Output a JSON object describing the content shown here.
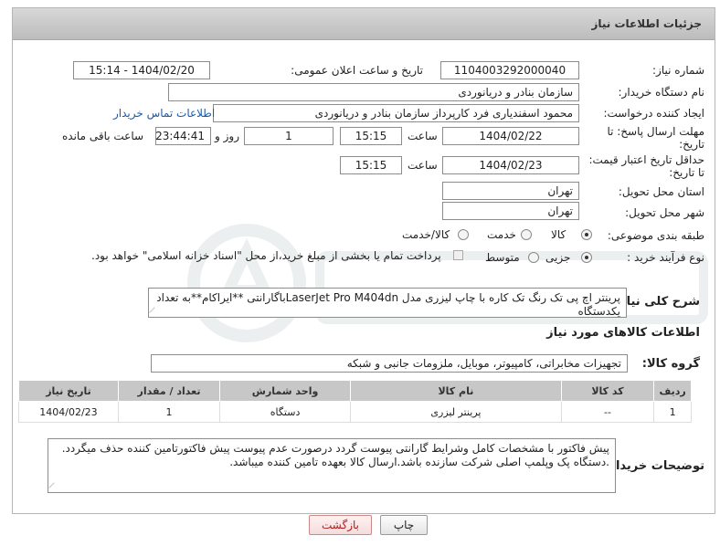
{
  "panel": {
    "title": "جزئیات اطلاعات نیاز"
  },
  "form": {
    "need_number": {
      "label": "شماره نیاز:",
      "value": "1104003292000040"
    },
    "announce": {
      "label": "تاریخ و ساعت اعلان عمومی:",
      "value": "1404/02/20 - 15:14"
    },
    "buyer_org": {
      "label": "نام دستگاه خریدار:",
      "value": "سازمان بنادر و دریانوردی"
    },
    "creator": {
      "label": "ایجاد کننده درخواست:",
      "value": "محمود اسفندیاری فرد کارپرداز سازمان بنادر و دریانوردی",
      "contact_link": "اطلاعات تماس خریدار"
    },
    "deadline": {
      "label_line1": "مهلت ارسال پاسخ: تا",
      "label_line2": "تاریخ:",
      "date": "1404/02/22",
      "time_label": "ساعت",
      "time": "15:15",
      "days": "1",
      "days_label": "روز و",
      "remaining": "23:44:41",
      "remaining_label": "ساعت باقی مانده"
    },
    "price_validity": {
      "label_line1": "حداقل تاریخ اعتبار قیمت:",
      "label_line2": "تا تاریخ:",
      "date": "1404/02/23",
      "time_label": "ساعت",
      "time": "15:15"
    },
    "province": {
      "label": "استان محل تحویل:",
      "value": "تهران"
    },
    "city": {
      "label": "شهر محل تحویل:",
      "value": "تهران"
    },
    "category": {
      "label": "طبقه بندی موضوعی:",
      "options": [
        "کالا",
        "خدمت",
        "کالا/خدمت"
      ],
      "selected": "کالا"
    },
    "purchase_process": {
      "label": "نوع فرآیند خرید :",
      "options": [
        "جزیی",
        "متوسط"
      ],
      "selected": "جزیی",
      "note": "پرداخت تمام یا بخشی از مبلغ خرید،از محل \"اسناد خزانه اسلامی\" خواهد بود."
    },
    "description": {
      "label": "شرح کلی نیاز:",
      "value": "پرینتر اچ پی تک رنگ تک کاره با چاپ لیزری مدل LaserJet Pro M404dnباگارانتی **ایراکام**به تعداد یکدستگاه"
    }
  },
  "goods": {
    "section_title": "اطلاعات کالاهای مورد نیاز",
    "group_label": "گروه کالا:",
    "group_value": "تجهیزات مخابراتی، کامپیوتر، موبایل، ملزومات جانبی و شبکه",
    "table": {
      "headers": [
        "ردیف",
        "کد کالا",
        "نام کالا",
        "واحد شمارش",
        "تعداد / مقدار",
        "تاریخ نیاز"
      ],
      "rows": [
        [
          "1",
          "--",
          "پرینتر لیزری",
          "دستگاه",
          "1",
          "1404/02/23"
        ]
      ]
    }
  },
  "buyer_notes": {
    "label": "توضیحات خریدار:",
    "line1": "پیش فاکتور با مشخصات کامل وشرایط گارانتی پیوست گردد درصورت عدم پیوست پیش فاکتورتامین کننده حذف میگردد.",
    "line2": ".دستگاه پک وپلمپ اصلی شرکت سازنده باشد.ارسال کالا بعهده تامین کننده میباشد."
  },
  "buttons": {
    "print": "چاپ",
    "back": "بازگشت"
  },
  "colors": {
    "link": "#1a5aa8",
    "header_bg": "#c9c9c9",
    "back_text": "#b21e1e"
  }
}
